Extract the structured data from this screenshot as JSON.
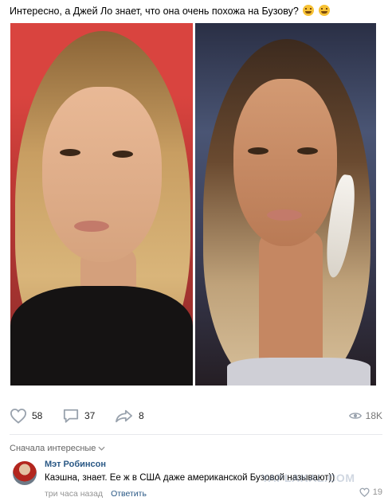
{
  "post": {
    "text": "Интересно, а Джей Ло знает, что она очень похожа на Бузову?"
  },
  "actions": {
    "likes": "58",
    "comments": "37",
    "shares": "8",
    "views": "18K"
  },
  "comments_section": {
    "sort_label": "Сначала интересные"
  },
  "comment": {
    "author": "Мэт Робинсон",
    "text": "Каэшна, знает. Ее ж в США даже американской Бузовой называют))",
    "time": "три часа назад",
    "reply_label": "Ответить",
    "likes": "19"
  },
  "watermark": "YAPLAKAL.COM",
  "icons": {
    "like": "heart-icon",
    "comment": "comment-icon",
    "share": "share-arrow-icon",
    "views": "eye-icon",
    "chevron": "chevron-down-icon",
    "emoji": "grinning-sweat-emoji"
  },
  "colors": {
    "link": "#2a5885",
    "muted": "#939393",
    "icon": "#99a2ad"
  }
}
